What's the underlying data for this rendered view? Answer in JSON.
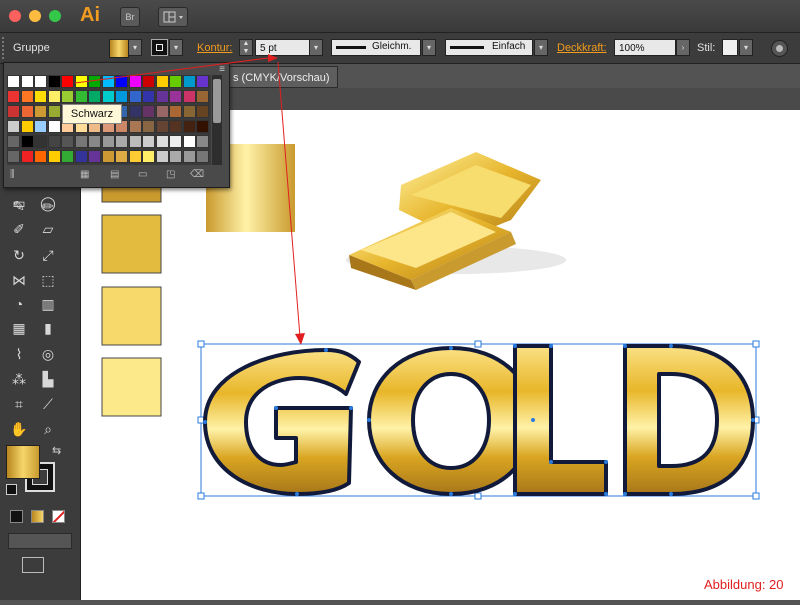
{
  "app": {
    "logo": "Ai",
    "bridge": "Br",
    "workspace_icon": "layout-icon"
  },
  "controlbar": {
    "selection_label": "Gruppe",
    "stroke_label": "Kontur:",
    "stroke_value": "5 pt",
    "profile_label": "Gleichm.",
    "brush_label": "Einfach",
    "opacity_label": "Deckkraft:",
    "opacity_value": "100%",
    "style_label": "Stil:"
  },
  "document": {
    "tab_label": "s (CMYK/Vorschau)"
  },
  "swatch_panel": {
    "tooltip": "Schwarz",
    "menu_icon": "panel-menu-icon"
  },
  "canvas": {
    "word": "GOLD",
    "figure_label": "Abbildung: 20"
  },
  "colors": {
    "accent": "#f29c1f",
    "selection": "#2a7bde",
    "gold": "#e8c23a",
    "arrow": "#e02020"
  },
  "gold_squares": [
    "#c99a2e",
    "#e3bb3f",
    "#f6d96a",
    "#fbe98a"
  ]
}
